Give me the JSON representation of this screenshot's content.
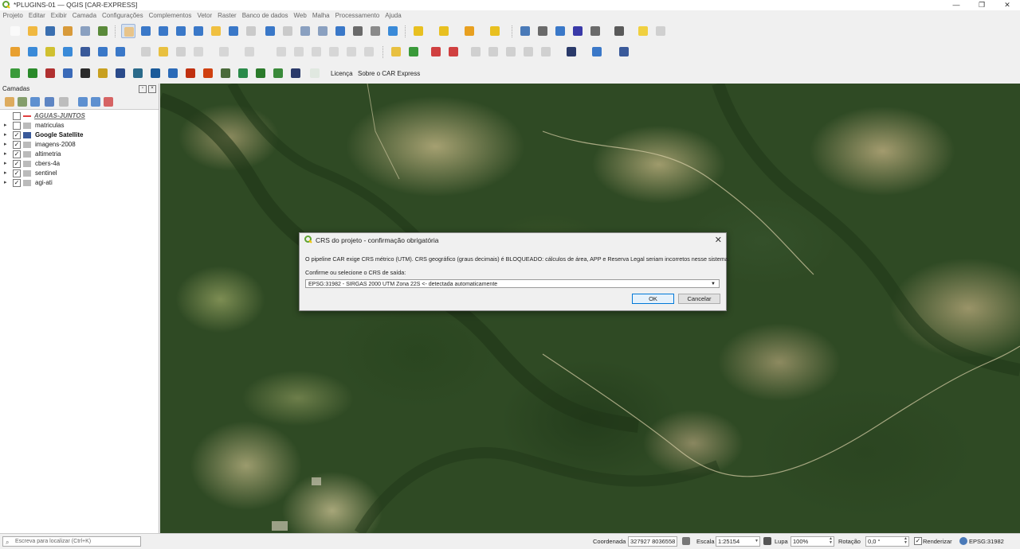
{
  "window": {
    "title": "*PLUGINS-01 — QGIS [CAR-EXPRESS]",
    "controls": [
      "—",
      "❐",
      "✕"
    ]
  },
  "menu": [
    "Projeto",
    "Editar",
    "Exibir",
    "Camada",
    "Configurações",
    "Complementos",
    "Vetor",
    "Raster",
    "Banco de dados",
    "Web",
    "Malha",
    "Processamento",
    "Ajuda"
  ],
  "toolbar3": {
    "license_label": "Licença",
    "about_label": "Sobre o CAR Express"
  },
  "layers_panel": {
    "title": "Camadas",
    "layers": [
      {
        "name": "AGUAS-JUNTOS",
        "checked": false,
        "type": "group"
      },
      {
        "name": "matriculas",
        "checked": false,
        "type": "normal"
      },
      {
        "name": "Google Satellite",
        "checked": true,
        "type": "bold"
      },
      {
        "name": "imagens-2008",
        "checked": true,
        "type": "normal"
      },
      {
        "name": "altimetria",
        "checked": true,
        "type": "normal"
      },
      {
        "name": "cbers-4a",
        "checked": true,
        "type": "normal"
      },
      {
        "name": "sentinel",
        "checked": true,
        "type": "normal"
      },
      {
        "name": "agi-ati",
        "checked": true,
        "type": "normal"
      }
    ]
  },
  "dialog": {
    "title": "CRS do projeto - confirmação obrigatória",
    "message": "O pipeline CAR exige CRS métrico (UTM). CRS geográfico (graus decimais) é BLOQUEADO: cálculos de área, APP e Reserva Legal seriam incorretos nesse sistema.",
    "select_label": "Confirme ou selecione o CRS de saída:",
    "selected_crs": "EPSG:31982 - SIRGAS 2000 UTM Zona 22S  <- detectada automaticamente",
    "ok_label": "OK",
    "cancel_label": "Cancelar",
    "close": "✕"
  },
  "status": {
    "locator_placeholder": "Escreva para localizar (Ctrl+K)",
    "coord_label": "Coordenada",
    "coord_value": "327927  8036558",
    "scale_label": "Escala",
    "scale_value": "1:25154",
    "magnifier_label": "Lupa",
    "magnifier_value": "100%",
    "rotation_label": "Rotação",
    "rotation_value": "0,0 °",
    "render_label": "Renderizar",
    "crs_label": "EPSG:31982"
  },
  "colors": {
    "qgis_green": "#5fa331",
    "qgis_yellow": "#f3c400",
    "dialog_ok_border": "#0078d7"
  }
}
